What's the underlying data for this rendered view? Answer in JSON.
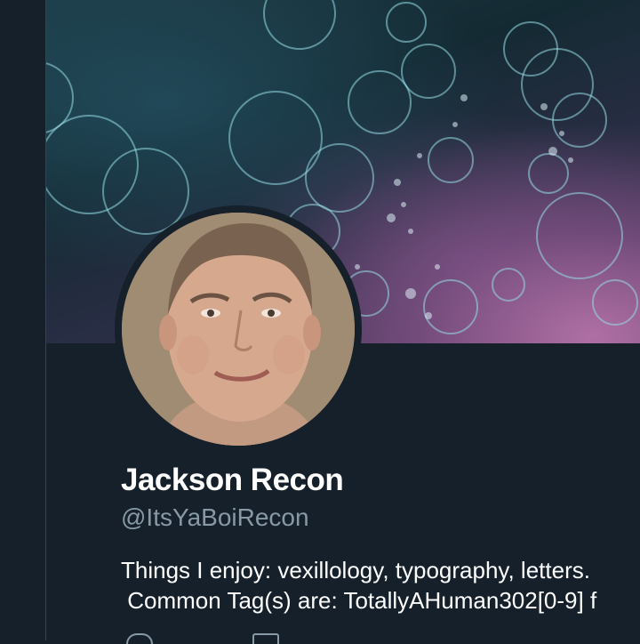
{
  "profile": {
    "display_name": "Jackson Recon",
    "handle": "@ItsYaBoiRecon",
    "bio_line1": "Things I enjoy: vexillology, typography, letters.",
    "bio_line2": " Common Tag(s) are: TotallyAHuman302[0-9] f"
  },
  "icons": {
    "location": "location-pin-icon",
    "calendar": "calendar-icon"
  },
  "colors": {
    "background": "#15202b",
    "divider": "#38444d",
    "name_text": "#ffffff",
    "handle_text": "#8899a6"
  }
}
